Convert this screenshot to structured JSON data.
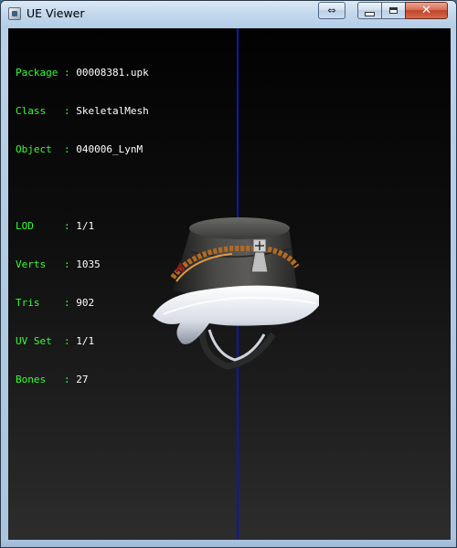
{
  "window": {
    "title": "UE Viewer",
    "buttons": {
      "extra": "⇔",
      "minimize": "",
      "maximize": "",
      "close": "✕"
    }
  },
  "info": {
    "package": {
      "label": "Package",
      "sep": ":",
      "value": "00008381.upk"
    },
    "class": {
      "label": "Class  ",
      "sep": ":",
      "value": "SkeletalMesh"
    },
    "object": {
      "label": "Object ",
      "sep": ":",
      "value": "040006_LynM"
    },
    "lod": {
      "label": "LOD    ",
      "sep": ":",
      "value": "1/1"
    },
    "verts": {
      "label": "Verts  ",
      "sep": ":",
      "value": "1035"
    },
    "tris": {
      "label": "Tris   ",
      "sep": ":",
      "value": "902"
    },
    "uvset": {
      "label": "UV Set ",
      "sep": ":",
      "value": "1/1"
    },
    "bones": {
      "label": "Bones  ",
      "sep": ":",
      "value": "27"
    }
  },
  "colors": {
    "label_color": "#33ff33",
    "value_color": "#ffffff",
    "axis_color": "#0a1aa8",
    "background_top": "#020202",
    "background_bottom": "#2d2d2d"
  },
  "mesh": {
    "icon": "hat-mesh-icon"
  }
}
